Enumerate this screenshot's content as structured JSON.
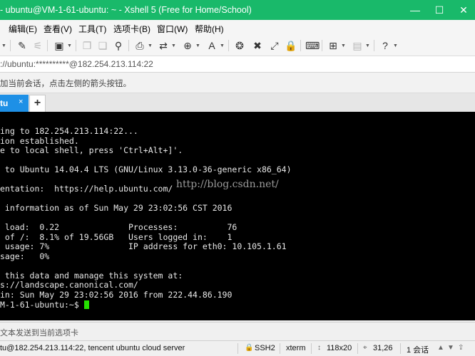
{
  "window": {
    "title": "- ubuntu@VM-1-61-ubuntu: ~ - Xshell 5 (Free for Home/School)"
  },
  "menu": [
    {
      "label": "编辑(E)"
    },
    {
      "label": "查看(V)"
    },
    {
      "label": "工具(T)"
    },
    {
      "label": "选项卡(B)"
    },
    {
      "label": "窗口(W)"
    },
    {
      "label": "帮助(H)"
    }
  ],
  "address": {
    "value": "://ubuntu:**********@182.254.213.114:22"
  },
  "hint": {
    "text": "加当前会话，点击左侧的箭头按钮。"
  },
  "tabs": [
    {
      "label": "tu",
      "close": "×"
    }
  ],
  "new_tab": "+",
  "terminal": {
    "lines": [
      "ing to 182.254.213.114:22...",
      "ion established.",
      "e to local shell, press 'Ctrl+Alt+]'.",
      "",
      " to Ubuntu 14.04.4 LTS (GNU/Linux 3.13.0-36-generic x86_64)",
      "",
      "entation:  https://help.ubuntu.com/",
      "",
      " information as of Sun May 29 23:02:56 CST 2016",
      "",
      " load:  0.22              Processes:          76",
      " of /:  8.1% of 19.56GB   Users logged in:    1",
      " usage: 7%                IP address for eth0: 10.105.1.61",
      "sage:   0%",
      "",
      " this data and manage this system at:",
      "s://landscape.canonical.com/",
      "in: Sun May 29 23:02:56 2016 from 222.44.86.190"
    ],
    "prompt": "M-1-61-ubuntu:~$ ",
    "watermark": "http://blog.csdn.net/"
  },
  "input_bar": {
    "placeholder": "文本发送到当前选项卡"
  },
  "status": {
    "connection": "tu@182.254.213.114:22, tencent ubuntu cloud server",
    "protocol": "SSH2",
    "terminal_type": "xterm",
    "size": "118x20",
    "cursor_pos": "31,26",
    "sessions": "1 会话"
  },
  "icons": {
    "minimize": "minimize-icon",
    "maximize": "maximize-icon",
    "close": "close-icon"
  }
}
